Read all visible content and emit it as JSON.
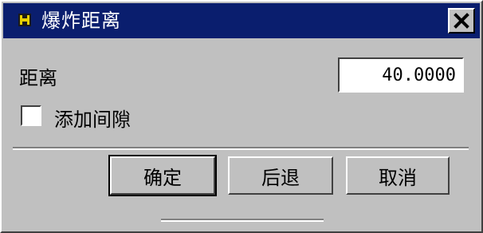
{
  "window": {
    "title": "爆炸距离",
    "icon": "window-app-icon",
    "close_icon": "close-x-icon"
  },
  "form": {
    "distance_label": "距离",
    "distance_value": "40.0000",
    "add_gap_label": "添加间隙",
    "add_gap_checked": false
  },
  "buttons": {
    "ok_label": "确定",
    "back_label": "后退",
    "cancel_label": "取消"
  },
  "colors": {
    "titlebar": "#0a1e6e",
    "face": "#c0c0c0"
  }
}
